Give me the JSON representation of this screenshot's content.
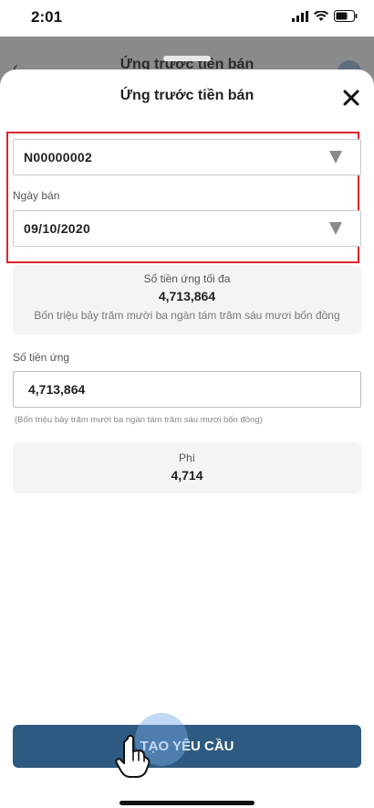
{
  "status_bar": {
    "time": "2:01"
  },
  "background_page": {
    "title": "Ứng trước tiền bán"
  },
  "sheet": {
    "title": "Ứng trước tiền bán",
    "account": {
      "value": "N00000002"
    },
    "sale_date": {
      "label": "Ngày bán",
      "value": "09/10/2020"
    },
    "max_advance": {
      "caption": "Số tiền ứng tối đa",
      "amount": "4,713,864",
      "in_words": "Bốn triệu bảy trăm mười ba ngàn tám trăm sáu mươi bốn đồng"
    },
    "advance_amount": {
      "label": "Số tiền ứng",
      "value": "4,713,864",
      "in_words": "(Bốn triệu bảy trăm mười ba ngàn tám trăm sáu mươi bốn đồng)"
    },
    "fee": {
      "caption": "Phí",
      "amount": "4,714"
    },
    "submit_label": "TẠO YÊU CẦU"
  },
  "colors": {
    "primary_button": "#2d5a80",
    "highlight_border": "#d9262c",
    "card_background": "#f4f4f4"
  },
  "icons": [
    "signal-icon",
    "wifi-icon",
    "battery-icon",
    "close-icon",
    "chevron-down-icon",
    "tap-hand-icon"
  ]
}
